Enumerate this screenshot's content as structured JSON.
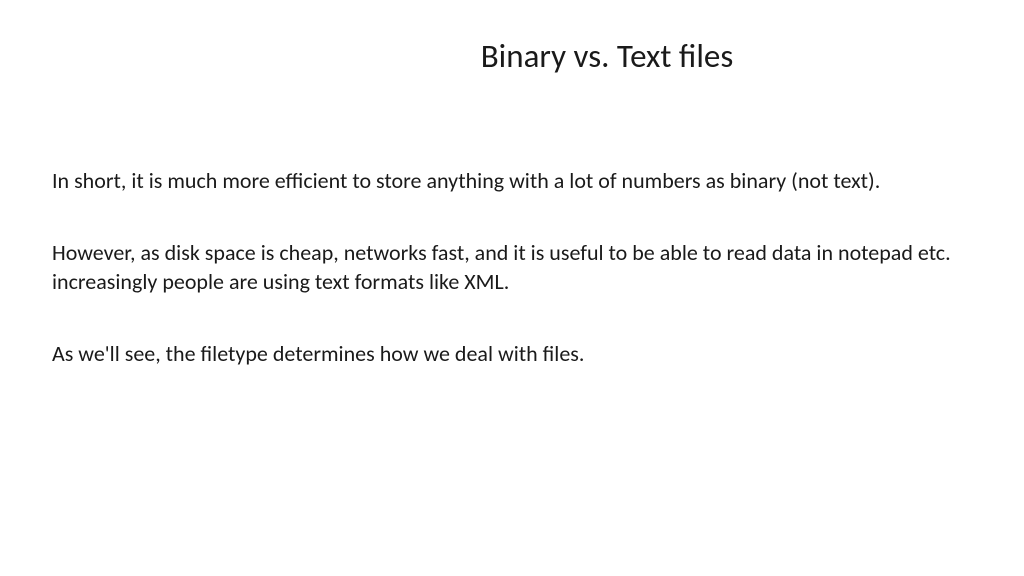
{
  "slide": {
    "title": "Binary vs. Text files",
    "paragraphs": [
      "In short, it is much more efficient to store anything with a lot of numbers as binary (not text).",
      "However, as disk space is cheap, networks fast, and it is useful to be able to read data in notepad etc. increasingly people are using text formats like XML.",
      "As we'll see, the filetype determines how we deal with files."
    ]
  }
}
